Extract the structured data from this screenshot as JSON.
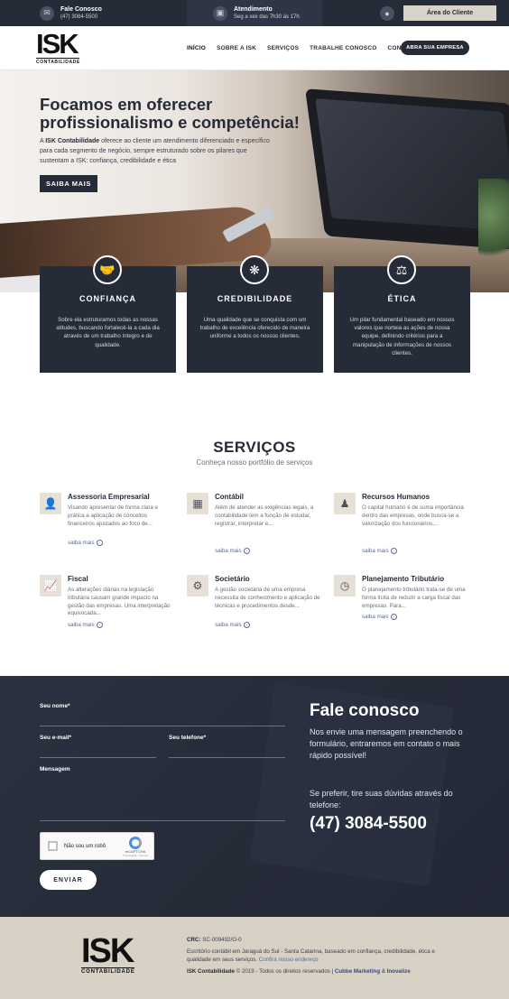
{
  "topbar": {
    "contact_label": "Fale Conosco",
    "contact_phone": "(47) 3084-5500",
    "hours_label": "Atendimento",
    "hours_value": "Seg a sex das 7h30 às 17h",
    "client_button": "Área do Cliente"
  },
  "header": {
    "logo_main": "ISK",
    "logo_sub": "CONTABILIDADE",
    "nav": [
      "INÍCIO",
      "SOBRE A ISK",
      "SERVIÇOS",
      "TRABALHE CONOSCO",
      "CONTATO"
    ],
    "open_company_button": "ABRA SUA EMPRESA"
  },
  "hero": {
    "title": "Focamos em oferecer profissionalismo e competência!",
    "text_pre": "A ",
    "text_brand": "ISK Contabilidade",
    "text_post": " oferece ao cliente um atendimento diferenciado e específico para cada segmento de negócio, sempre estruturado sobre os pilares que sustentam a ISK: confiança, credibilidade e ética",
    "button": "SAIBA MAIS"
  },
  "values": [
    {
      "icon": "handshake-icon",
      "title": "CONFIANÇA",
      "text": "Sobre ela estruturamos todas as nossas atitudes, buscando fortalecê-la a cada dia através de um trabalho íntegro e de qualidade."
    },
    {
      "icon": "laurel-icon",
      "title": "CREDIBILIDADE",
      "text": "Uma qualidade que se conquista com um trabalho de excelência oferecido de maneira uniforme a todos os nossos clientes."
    },
    {
      "icon": "scales-icon",
      "title": "ÉTICA",
      "text": "Um pilar fundamental baseado em nossos valores que norteia as ações de nossa equipe, definindo critérios para a manipulação de informações de nossos clientes."
    }
  ],
  "services": {
    "title": "SERVIÇOS",
    "subtitle": "Conheça nosso portfólio de serviços",
    "more_label": "saiba mais",
    "items": [
      {
        "icon": "consulting-icon",
        "name": "Assessoria Empresarial",
        "text": "Visando apresentar de forma clara e prática a aplicação de conceitos financeiros ajustados ao foco de..."
      },
      {
        "icon": "calculator-icon",
        "name": "Contábil",
        "text": "Além de atender as exigências legais, a contabilidade tem a função de estudar, registrar, interpretar e..."
      },
      {
        "icon": "team-icon",
        "name": "Recursos Humanos",
        "text": "O capital humano é de suma importância dentro das empresas, onde busca-se a valorização dos funcionários,..."
      },
      {
        "icon": "chart-icon",
        "name": "Fiscal",
        "text": "As alterações diárias na legislação tributária causam grande impacto na gestão das empresas. Uma interpretação equivocada..."
      },
      {
        "icon": "gears-icon",
        "name": "Societário",
        "text": "A gestão societária de uma empresa necessita de conhecimento e aplicação de técnicas e procedimentos desde..."
      },
      {
        "icon": "planning-icon",
        "name": "Planejamento Tributário",
        "text": "O planejamento tributário trata-se de uma forma lícita de reduzir a carga fiscal das empresas. Para..."
      }
    ]
  },
  "contact": {
    "name_label": "Seu nome*",
    "email_label": "Seu e-mail*",
    "phone_label": "Seu telefone*",
    "message_label": "Mensagem",
    "captcha_text": "Não sou um robô",
    "captcha_brand": "reCAPTCHA",
    "captcha_links": "Privacidade - Termos",
    "send_button": "ENVIAR",
    "title": "Fale conosco",
    "text": "Nos envie uma mensagem preenchendo o formulário, entraremos em contato o mais rápido possível!",
    "text2": "Se preferir, tire suas dúvidas através do telefone:",
    "phone": "(47) 3084-5500"
  },
  "footer": {
    "crc_label": "CRC:",
    "crc_value": " SC-009492/O-0",
    "address": "Escritório contábil em Jaraguá do Sul - Santa Catarina, baseado em confiança, credibilidade, ética e qualidade em seus serviços. ",
    "address_link": "Confira nosso endereço",
    "brand": "ISK Contabilidade",
    "copyright": " © 2019 - Todos os direitos reservados | ",
    "agency1": "Cubbe Marketing",
    "amp": " & ",
    "agency2": "Inovalize"
  }
}
